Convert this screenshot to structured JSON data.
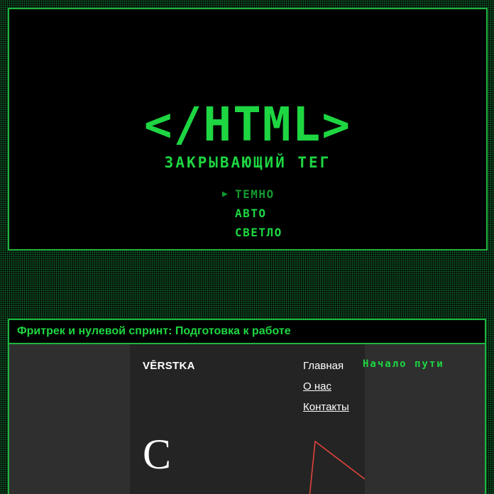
{
  "hero": {
    "logo": "</HTML>",
    "subtitle": "ЗАКРЫВАЮЩИЙ ТЕГ",
    "theme_options": [
      {
        "label": "ТЕМНО",
        "marker": "▶",
        "selected": true
      },
      {
        "label": "АВТО",
        "marker": "",
        "selected": false
      },
      {
        "label": "СВЕТЛО",
        "marker": "",
        "selected": false
      }
    ]
  },
  "post": {
    "title": "Фритрек и нулевой спринт: Подготовка к работе",
    "preview": {
      "site_logo": "VĒRSTKA",
      "nav": [
        "Главная",
        "О нас",
        "Контакты"
      ],
      "big_letter": "С",
      "caption": "Начало пути"
    }
  },
  "colors": {
    "accent": "#1dd642",
    "border": "#1fb53f",
    "background": "#000000",
    "preview_bg": "#2f2f2f",
    "site_bg": "#242424",
    "deco_red": "#e0443a",
    "deco_yellow": "#e8c22a"
  }
}
